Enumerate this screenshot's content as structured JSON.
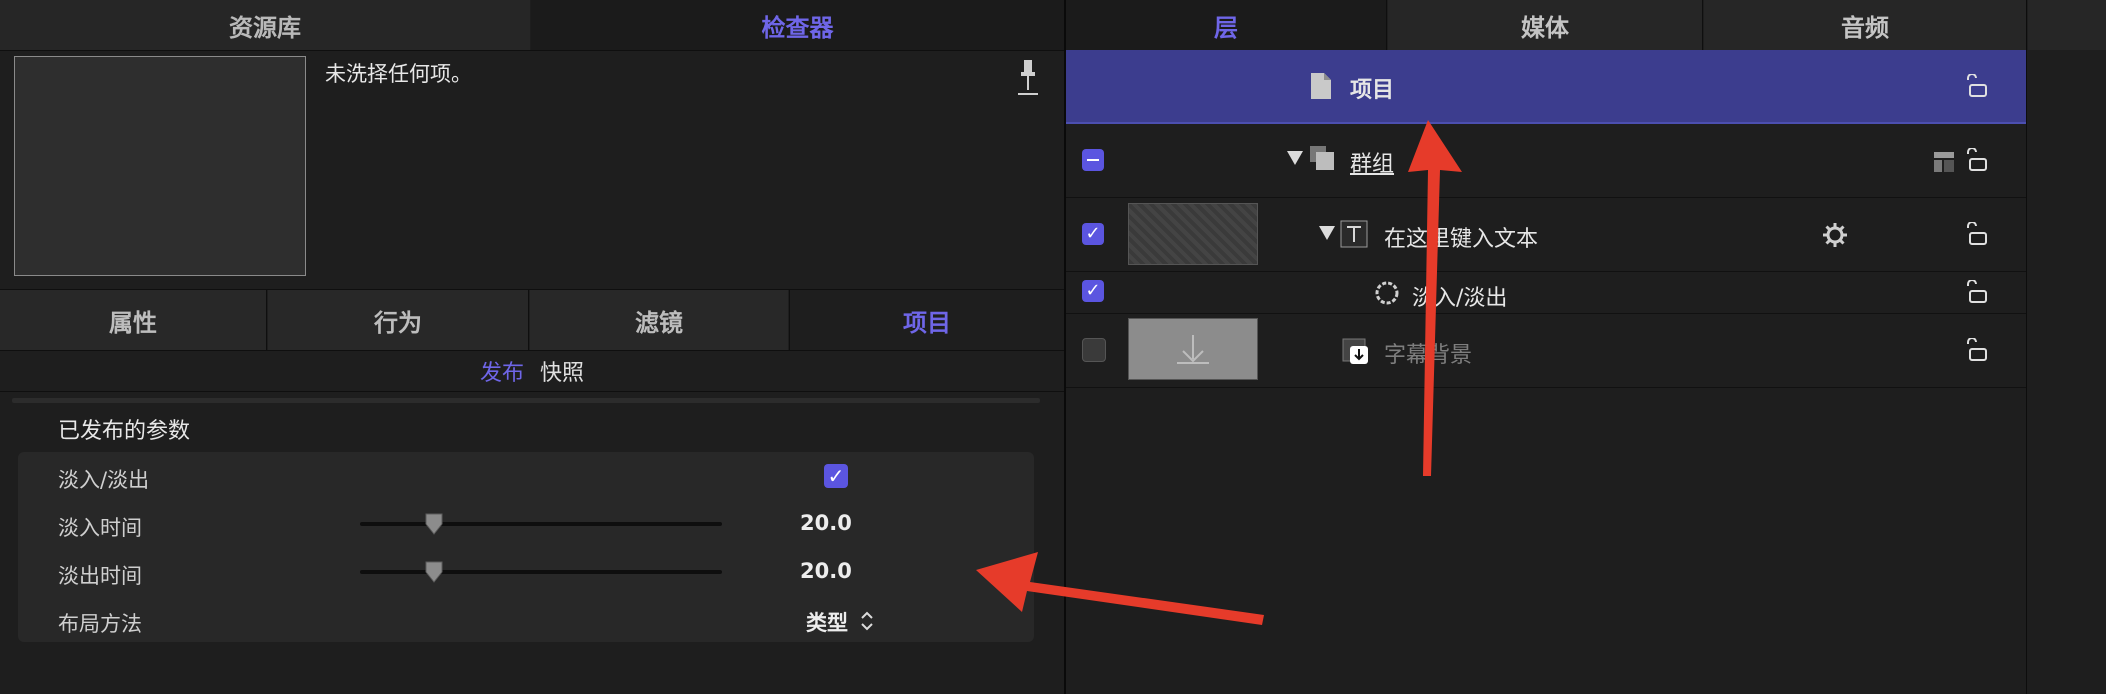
{
  "left": {
    "tabs": [
      {
        "label": "资源库",
        "active": false
      },
      {
        "label": "检查器",
        "active": true
      }
    ],
    "no_selection": "未洗择任何项。",
    "sub_tabs": [
      {
        "label": "属性",
        "active": false
      },
      {
        "label": "行为",
        "active": false
      },
      {
        "label": "滤镜",
        "active": false
      },
      {
        "label": "项目",
        "active": true
      }
    ],
    "publish_tabs": {
      "publish": "发布",
      "snapshot": "快照"
    },
    "params_title": "已发布的参数",
    "params": {
      "fade": {
        "label": "淡入/淡出",
        "checked": true
      },
      "fade_in": {
        "label": "淡入时间",
        "value": "20.0",
        "slider_fraction": 0.2
      },
      "fade_out": {
        "label": "淡出时间",
        "value": "20.0",
        "slider_fraction": 0.2
      },
      "layout": {
        "label": "布局方法",
        "value": "类型"
      }
    }
  },
  "right": {
    "tabs": [
      {
        "label": "层",
        "active": true
      },
      {
        "label": "媒体",
        "active": false
      },
      {
        "label": "音频",
        "active": false
      }
    ],
    "layers": {
      "project": {
        "label": "项目",
        "icon": "document-icon"
      },
      "group": {
        "label": "群组",
        "icon": "group-icon"
      },
      "text": {
        "label": "在这里键入文本",
        "icon": "text-layer-icon"
      },
      "fade": {
        "label": "淡入/淡出",
        "icon": "behavior-gear-icon"
      },
      "background": {
        "label": "字幕背景",
        "icon": "drop-zone-icon"
      }
    }
  },
  "colors": {
    "accent": "#6f66e8",
    "project_row": "#3c3d8e",
    "annotation_arrow": "#e63b2a"
  }
}
